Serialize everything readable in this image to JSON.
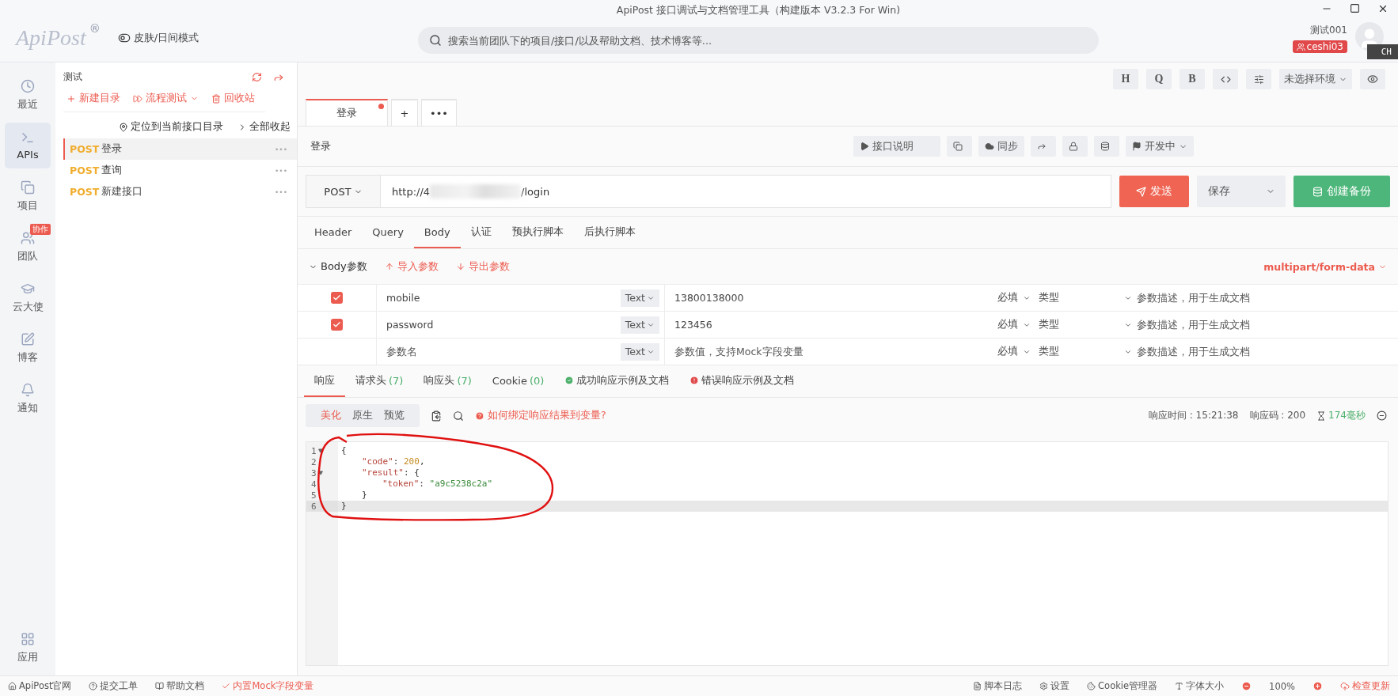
{
  "window": {
    "title": "ApiPost 接口调试与文档管理工具（构建版本 V3.2.3 For Win)"
  },
  "header": {
    "logo": "ApiPost",
    "logo_mark": "®",
    "theme_toggle": "皮肤/日间模式",
    "search": {
      "placeholder": "搜索当前团队下的项目/接口/以及帮助文档、技术博客等..."
    },
    "user_name": "测试001",
    "team_badge": "ceshi03",
    "ime_indicator": "CH"
  },
  "rail": {
    "items": [
      {
        "label": "最近",
        "selected": false
      },
      {
        "label": "APIs",
        "selected": true
      },
      {
        "label": "项目",
        "selected": false
      },
      {
        "label": "团队",
        "selected": false,
        "badge": "协作"
      },
      {
        "label": "云大使",
        "selected": false
      },
      {
        "label": "博客",
        "selected": false
      },
      {
        "label": "通知",
        "selected": false
      }
    ],
    "bottom_item": {
      "label": "应用"
    }
  },
  "tree": {
    "project": "测试",
    "actions": [
      {
        "label": "新建目录",
        "kind": "plus"
      },
      {
        "label": "流程测试",
        "kind": "dropdown"
      },
      {
        "label": "回收站",
        "kind": "trash"
      }
    ],
    "locate": "定位到当前接口目录",
    "collapse_all": "全部收起",
    "items": [
      {
        "method": "POST",
        "name": "登录",
        "selected": true,
        "more": "•••"
      },
      {
        "method": "POST",
        "name": "查询",
        "selected": false,
        "more": "•••"
      },
      {
        "method": "POST",
        "name": "新建接口",
        "selected": false,
        "more": "•••"
      }
    ]
  },
  "toolbar": {
    "buttons": [
      "H",
      "Q",
      "B"
    ],
    "environment": "未选择环境"
  },
  "doc_tabs": {
    "tabs": [
      {
        "label": "登录",
        "selected": true,
        "unsaved": true
      }
    ],
    "add": "+",
    "more": "•••"
  },
  "request": {
    "title": "登录",
    "actions": [
      {
        "label": "接口说明",
        "kind": "play"
      },
      {
        "kind": "copy"
      },
      {
        "label": "同步",
        "kind": "cloud"
      },
      {
        "kind": "share"
      },
      {
        "kind": "lock"
      },
      {
        "kind": "database"
      },
      {
        "label": "开发中",
        "kind": "flag"
      }
    ],
    "method": "POST",
    "url_start": "http://4",
    "url_end": "/login",
    "send": "发送",
    "save": "保存",
    "backup": "创建备份",
    "tabs": [
      {
        "label": "Header",
        "selected": false
      },
      {
        "label": "Query",
        "selected": false
      },
      {
        "label": "Body",
        "selected": true
      },
      {
        "label": "认证",
        "selected": false
      },
      {
        "label": "预执行脚本",
        "selected": false
      },
      {
        "label": "后执行脚本",
        "selected": false
      }
    ],
    "body": {
      "title": "Body参数",
      "import": "导入参数",
      "export": "导出参数",
      "content_type": "multipart/form-data",
      "params": [
        {
          "checked": true,
          "name": "mobile",
          "type": "Text",
          "value": "13800138000",
          "required": "必填",
          "field_type": "类型",
          "description_placeholder": "参数描述，用于生成文档"
        },
        {
          "checked": true,
          "name": "password",
          "type": "Text",
          "value": "123456",
          "required": "必填",
          "field_type": "类型",
          "description_placeholder": "参数描述，用于生成文档"
        },
        {
          "checked": false,
          "name_placeholder": "参数名",
          "type": "Text",
          "value_placeholder": "参数值，支持Mock字段变量",
          "required": "必填",
          "field_type": "类型",
          "description_placeholder": "参数描述，用于生成文档"
        }
      ]
    }
  },
  "response": {
    "tabs": [
      {
        "label": "响应",
        "selected": true
      },
      {
        "label": "请求头",
        "count": "(7)",
        "selected": false
      },
      {
        "label": "响应头",
        "count": "(7)",
        "selected": false
      },
      {
        "label": "Cookie",
        "count": "(0)",
        "selected": false
      },
      {
        "label": "成功响应示例及文档",
        "kind": "success",
        "selected": false
      },
      {
        "label": "错误响应示例及文档",
        "kind": "error",
        "selected": false
      }
    ],
    "views": [
      {
        "label": "美化",
        "selected": true
      },
      {
        "label": "原生",
        "selected": false
      },
      {
        "label": "预览",
        "selected": false
      }
    ],
    "help": "如何绑定响应结果到变量?",
    "time_label": "响应时间 : 15:21:38",
    "code_label": "响应码 : 200",
    "duration": "174毫秒",
    "lines": [
      {
        "number": "1",
        "fold": true,
        "active": false,
        "tokens": [
          {
            "t": "{",
            "kind": "punct"
          }
        ]
      },
      {
        "number": "2",
        "fold": false,
        "active": false,
        "tokens": [
          {
            "t": "\"code\"",
            "kind": "key"
          },
          {
            "t": ": ",
            "kind": "punct"
          },
          {
            "t": "200",
            "kind": "num"
          },
          {
            "t": ",",
            "kind": "punct"
          }
        ]
      },
      {
        "number": "3",
        "fold": true,
        "active": false,
        "tokens": [
          {
            "t": "\"result\"",
            "kind": "key"
          },
          {
            "t": ": {",
            "kind": "punct"
          }
        ]
      },
      {
        "number": "4",
        "fold": false,
        "active": false,
        "tokens": [
          {
            "t": "\"token\"",
            "kind": "key"
          },
          {
            "t": ": ",
            "kind": "punct"
          },
          {
            "t": "\"a9c5238c2a\"",
            "kind": "str"
          }
        ]
      },
      {
        "number": "5",
        "fold": false,
        "active": false,
        "tokens": [
          {
            "t": "}",
            "kind": "punct"
          }
        ]
      },
      {
        "number": "6",
        "fold": false,
        "active": true,
        "tokens": [
          {
            "t": "}",
            "kind": "punct"
          }
        ]
      }
    ]
  },
  "status_bar": {
    "left": [
      {
        "label": "ApiPost官网",
        "kind": "home"
      },
      {
        "label": "提交工单",
        "kind": "help"
      },
      {
        "label": "帮助文档",
        "kind": "book"
      },
      {
        "label": "内置Mock字段变量",
        "kind": "mock"
      }
    ],
    "right": [
      {
        "label": "脚本日志",
        "kind": "log"
      },
      {
        "label": "设置",
        "kind": "gear"
      },
      {
        "label": "Cookie管理器",
        "kind": "cookie"
      },
      {
        "label": "字体大小",
        "kind": "font"
      }
    ],
    "zoom": "100%",
    "update": "检查更新"
  }
}
